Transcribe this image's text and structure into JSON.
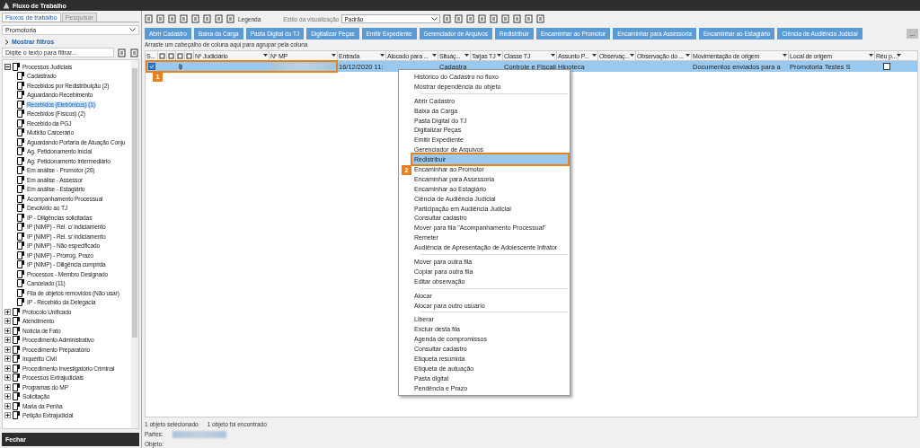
{
  "window": {
    "title": "Fluxo de Trabalho"
  },
  "sidebar": {
    "tabs": [
      {
        "label": "Fluxos de trabalho",
        "selected": true
      },
      {
        "label": "Pesquisar",
        "selected": false
      }
    ],
    "dropdown": {
      "value": "Promotoria"
    },
    "filters_link": "Mostrar filtros",
    "filter": {
      "placeholder": "Digite o texto para filtrar..."
    },
    "tree": [
      {
        "label": "Processos Judiciais",
        "expanded": true,
        "selected": false,
        "children": [
          {
            "label": "Cadastrado",
            "selected": false
          },
          {
            "label": "Recebidos por Redistribuição (2)",
            "selected": false
          },
          {
            "label": "Aguardando Recebimento",
            "selected": false
          },
          {
            "label": "Recebidos (Eletrônicos) (1)",
            "selected": true
          },
          {
            "label": "Recebidos (Físicos) (2)",
            "selected": false
          },
          {
            "label": "Recebido da PGJ",
            "selected": false
          },
          {
            "label": "Mutirão Carcerário",
            "selected": false
          },
          {
            "label": "Aguardando Portaria de Atuação Conju",
            "selected": false
          },
          {
            "label": "Ag. Peticionamento Inicial",
            "selected": false
          },
          {
            "label": "Ag. Peticionamento Intermediário",
            "selected": false
          },
          {
            "label": "Em análise - Promotor (20)",
            "selected": false
          },
          {
            "label": "Em análise - Assessor",
            "selected": false
          },
          {
            "label": "Em análise - Estagiário",
            "selected": false
          },
          {
            "label": "Acompanhamento Processual",
            "selected": false
          },
          {
            "label": "Devolvido ao TJ",
            "selected": false
          },
          {
            "label": "IP - Diligências solicitadas",
            "selected": false
          },
          {
            "label": "IP (NIMP) - Rel. c/ indiciamento",
            "selected": false
          },
          {
            "label": "IP (NIMP) - Rel. s/ indiciamento",
            "selected": false
          },
          {
            "label": "IP (NIMP) - Não especificado",
            "selected": false
          },
          {
            "label": "IP (NIMP) - Prorrog. Prazo",
            "selected": false
          },
          {
            "label": "IP (NIMP) - Diligência cumprida",
            "selected": false
          },
          {
            "label": "Processos - Membro Designado",
            "selected": false
          },
          {
            "label": "Cancelado (11)",
            "selected": false
          },
          {
            "label": "Fila de objetos removidos (Não usar)",
            "selected": false
          },
          {
            "label": "IP - Recebido da Delegacia",
            "selected": false
          }
        ]
      },
      {
        "label": "Protocolo Unificado",
        "expanded": false,
        "selected": false
      },
      {
        "label": "Atendimento",
        "expanded": false,
        "selected": false
      },
      {
        "label": "Notícia de Fato",
        "expanded": false,
        "selected": false
      },
      {
        "label": "Procedimento Administrativo",
        "expanded": false,
        "selected": false
      },
      {
        "label": "Procedimento Preparatório",
        "expanded": false,
        "selected": false
      },
      {
        "label": "Inquérito Civil",
        "expanded": false,
        "selected": false
      },
      {
        "label": "Procedimento Investigatório Criminal",
        "expanded": false,
        "selected": false
      },
      {
        "label": "Processos Extrajudiciais",
        "expanded": false,
        "selected": false
      },
      {
        "label": "Programas do MP",
        "expanded": false,
        "selected": false
      },
      {
        "label": "Solicitação",
        "expanded": false,
        "selected": false
      },
      {
        "label": "Maria da Penha",
        "expanded": false,
        "selected": false
      },
      {
        "label": "Petição Extrajudicial",
        "expanded": false,
        "selected": false
      }
    ],
    "close_button": "Fechar"
  },
  "toolbar": {
    "legend": "Legenda",
    "view_style_label": "Estilo da visualização",
    "view_style": "Padrão"
  },
  "actions": [
    "Abrir Cadastro",
    "Baixa da Carga",
    "Pasta Digital do TJ",
    "Digitalizar Peças",
    "Emitir Expediente",
    "Gerenciador de Arquivos",
    "Redistribuir",
    "Encaminhar ao Promotor",
    "Encaminhar para Assessoria",
    "Encaminhar ao Estagiário",
    "Ciência de Audiência Judicial"
  ],
  "more_button": "...",
  "group_hint": "Arraste um cabeçalho de coluna aqui para agrupar pela coluna",
  "table": {
    "columns": [
      {
        "label": "S...",
        "kind": "text"
      },
      {
        "kind": "icon"
      },
      {
        "kind": "icon"
      },
      {
        "kind": "icon"
      },
      {
        "kind": "icon"
      },
      {
        "label": "Nº Judiciário",
        "kind": "text"
      },
      {
        "label": "Nº MP",
        "kind": "text"
      },
      {
        "label": "Entrada",
        "kind": "text"
      },
      {
        "label": "Alocado para ...",
        "kind": "text"
      },
      {
        "label": "Situaç...",
        "kind": "text"
      },
      {
        "label": "Tarjas TJ",
        "kind": "text"
      },
      {
        "label": "Classe TJ",
        "kind": "text"
      },
      {
        "label": "Assunto P...",
        "kind": "text"
      },
      {
        "label": "Observaç...",
        "kind": "text"
      },
      {
        "label": "Observação do ...",
        "kind": "text"
      },
      {
        "label": "Movimentação de origem",
        "kind": "text"
      },
      {
        "label": "Local de origem",
        "kind": "text"
      },
      {
        "label": "Réu p...",
        "kind": "text"
      }
    ],
    "rows": [
      {
        "selected": true,
        "checked": true,
        "callout": "1",
        "entrada": "16/12/2020 11:",
        "situacao": "Cadastra",
        "classe": "Controle e Fiscali",
        "assunto": "Hipoteca",
        "movimentacao": "Documentos enviados para a",
        "local": "Promotoria Testes S",
        "reu": false
      }
    ]
  },
  "context_menu": {
    "groups": [
      [
        {
          "label": "Histórico do Cadastro no fluxo",
          "selected": false
        },
        {
          "label": "Mostrar dependência do objeto",
          "selected": false
        }
      ],
      [
        {
          "label": "Abrir Cadastro",
          "selected": false
        },
        {
          "label": "Baixa da Carga",
          "selected": false
        },
        {
          "label": "Pasta Digital do TJ",
          "selected": false
        },
        {
          "label": "Digitalizar Peças",
          "selected": false
        },
        {
          "label": "Emitir Expediente",
          "selected": false
        },
        {
          "label": "Gerenciador de Arquivos",
          "selected": false
        },
        {
          "label": "Redistribuir",
          "selected": true,
          "callout": "2"
        },
        {
          "label": "Encaminhar ao Promotor",
          "selected": false
        },
        {
          "label": "Encaminhar para Assessoria",
          "selected": false
        },
        {
          "label": "Encaminhar ao Estagiário",
          "selected": false
        },
        {
          "label": "Ciência de Audiência Judicial",
          "selected": false
        },
        {
          "label": "Participação em Audiência Judicial",
          "selected": false
        },
        {
          "label": "Consultar cadastro",
          "selected": false
        },
        {
          "label": "Mover para fila \"Acompanhamento Processual\"",
          "selected": false
        },
        {
          "label": "Remeter",
          "selected": false
        },
        {
          "label": "Audiência de Apresentação de Adolescente Infrator",
          "selected": false
        }
      ],
      [
        {
          "label": "Mover para outra fila",
          "selected": false
        },
        {
          "label": "Copiar para outra fila",
          "selected": false
        },
        {
          "label": "Editar observação",
          "selected": false
        }
      ],
      [
        {
          "label": "Alocar",
          "selected": false
        },
        {
          "label": "Alocar para outro usuário",
          "selected": false
        }
      ],
      [
        {
          "label": "Liberar",
          "selected": false
        },
        {
          "label": "Excluir desta fila",
          "selected": false
        },
        {
          "label": "Agenda de compromissos",
          "selected": false
        },
        {
          "label": "Consultar cadastro",
          "selected": false
        },
        {
          "label": "Etiqueta resumida",
          "selected": false
        },
        {
          "label": "Etiqueta de autuação",
          "selected": false
        },
        {
          "label": "Pasta digital",
          "selected": false
        },
        {
          "label": "Pendência e Prazo",
          "selected": false
        }
      ]
    ]
  },
  "status": {
    "selected_count": "1 objeto selecionado",
    "found_count": "1 objeto foi encontrado",
    "parties_label": "Partes:",
    "object_label": "Objeto:"
  }
}
